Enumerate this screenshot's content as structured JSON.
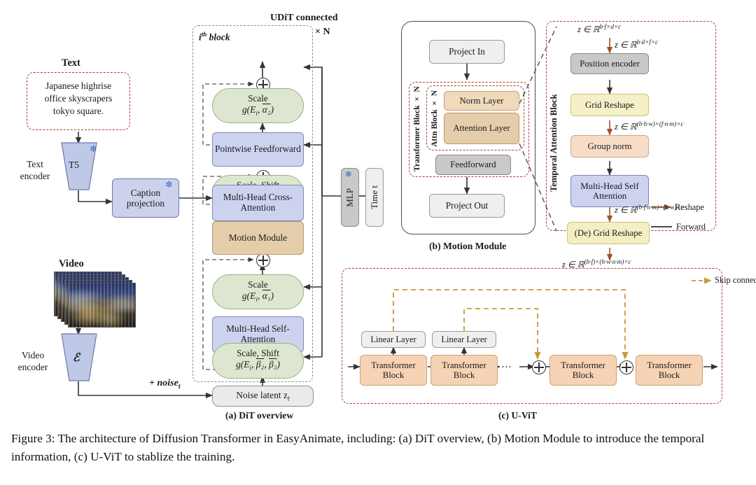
{
  "figure": {
    "caption": "Figure 3:  The architecture of Diffusion Transformer in EasyAnimate, including: (a) DiT overview, (b) Motion Module to introduce the temporal information, (c) U-ViT to stablize the training.",
    "subcaption_a": "(a) DiT overview",
    "subcaption_b": "(b) Motion Module",
    "subcaption_c": "(c) U-ViT"
  },
  "colors": {
    "dashed_red": "#a7402f",
    "dashed_grey": "#8d8d8d",
    "skip_connection": "#c79a3a",
    "reshape_arrow": "#a0522d",
    "blue_node": "#ccd2ec",
    "green_node": "#dde7cf",
    "tan_node": "#e4cdab",
    "peach_node": "#f6d3b4",
    "yellow_node": "#f6f0c8",
    "grey_node": "#ebebeb",
    "snowflake": "#3b63c4"
  },
  "panel_a": {
    "text_header": "Text",
    "prompt": "Japanese highrise office skyscrapers tokyo square.",
    "text_encoder_label": "Text encoder",
    "text_encoder_name": "T5",
    "caption_projection": "Caption projection",
    "video_header": "Video",
    "video_encoder_label": "Video encoder",
    "video_encoder_name": "ℰ",
    "noise_label": "+ noise",
    "noise_sub": "t",
    "noise_latent": "Noise latent z",
    "noise_latent_sub": "t",
    "block_label_i": "i",
    "block_label_sup": "th",
    "block_label_rest": " block",
    "udit_connected": "UDiT connected",
    "times_n": "× N",
    "mlp": "MLP",
    "time_t": "Time t",
    "boxes": {
      "scale_a2_title": "Scale",
      "scale_a2_formula_pre": "g(E",
      "scale_a2_formula_sub": "i",
      "scale_a2_formula_mid": ", ",
      "scale_a2_formula_var": "α₂",
      "scale_a2_formula_post": ")",
      "pointwise_feedforward": "Pointwise Feedforward",
      "scale_shift_title": "Scale, Shift",
      "scale_shift_var1": "β₂",
      "scale_shift_var2": "β₂",
      "cross_attention": "Multi-Head Cross-Attention",
      "motion_module": "Motion Module",
      "scale_a1_var": "α₁",
      "self_attention": "Multi-Head Self-Attention"
    }
  },
  "panel_b": {
    "project_in": "Project In",
    "project_out": "Project  Out",
    "transformer_block_n": "Transformer Block × N",
    "attn_block_n": "Attn Block × N",
    "norm_layer": "Norm Layer",
    "attention_layer": "Attention Layer",
    "feedforward": "Feedforward",
    "temporal_attention_block": "Temporal Attention Block",
    "position_encoder": "Position encoder",
    "grid_reshape": "Grid Reshape",
    "group_norm": "Group norm",
    "self_attention": "Multi-Head Self Attention",
    "de_grid_reshape": "(De) Grid Reshape",
    "legend_reshape": "Reshape",
    "legend_forward": "Forward",
    "shapes": {
      "top1": "z ∈ ℝ",
      "top1_sup": "b·f×d×c",
      "top2": "z ∈ ℝ",
      "top2_sup": "b·d×f×c",
      "mid": "z ∈ ℝ",
      "mid_sup": "(b·h·w)×(f·n·m)×c",
      "low": "z ∈ ℝ",
      "low_sup": "(b·f·n·m)×(h·w)×c",
      "bottom": "z ∈ ℝ",
      "bottom_sup": "(b·f)×(h·w·n·m)×c"
    }
  },
  "panel_c": {
    "skip_connection_legend": "Skip connection",
    "linear_layer_1": "Linear Layer",
    "linear_layer_2": "Linear Layer",
    "transformer_block_1": "Transformer Block",
    "transformer_block_2": "Transformer Block",
    "transformer_block_3": "Transformer Block",
    "transformer_block_4": "Transformer Block",
    "ellipsis": "…"
  }
}
